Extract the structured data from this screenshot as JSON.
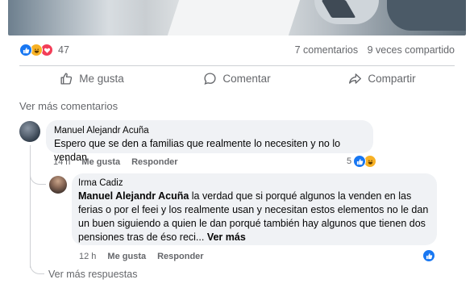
{
  "post": {
    "reaction_count": "47",
    "comments_count": "7 comentarios",
    "shares_count": "9 veces compartido",
    "actions": {
      "like": "Me gusta",
      "comment": "Comentar",
      "share": "Compartir"
    },
    "more_comments": "Ver más comentarios"
  },
  "comments": [
    {
      "author": "Manuel Alejandr Acuña",
      "text": "Espero que se den a familias que realmente lo necesiten y no lo vendan",
      "time": "14 h",
      "like_label": "Me gusta",
      "reply_label": "Responder",
      "reaction_count": "5"
    }
  ],
  "reply": {
    "author": "Irma Cadiz",
    "mention": "Manuel Alejandr Acuña",
    "text": " la verdad que si porqué algunos la venden en las ferias o por el feei y los realmente usan y necesitan estos elementos no le dan un buen siguiendo a quien le dan porqué también hay algunos que tienen dos pensiones tras de éso reci...",
    "see_more": " Ver más",
    "time": "12 h",
    "like_label": "Me gusta",
    "reply_label": "Responder"
  },
  "more_replies": "Ver más respuestas",
  "colors": {
    "like": "#1877f2",
    "haha": "#f7b125",
    "love": "#f33e58",
    "muted": "#65676b",
    "bubble": "#f0f2f5"
  }
}
